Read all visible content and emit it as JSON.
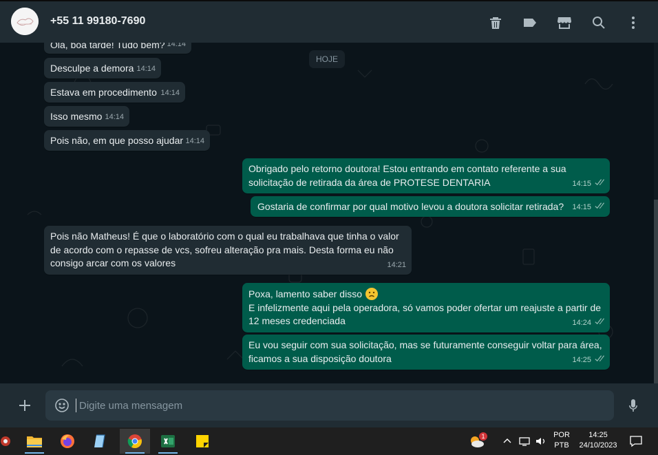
{
  "header": {
    "contact_name": "+55 11 99180-7690",
    "icons": [
      "trash-icon",
      "label-icon",
      "store-icon",
      "search-icon",
      "more-icon"
    ]
  },
  "chat": {
    "date_chip": "HOJE",
    "messages": [
      {
        "dir": "in",
        "text": "Olá, boa tarde! Tudo bem?",
        "time": "14:14"
      },
      {
        "dir": "in",
        "text": "Desculpe a demora",
        "time": "14:14"
      },
      {
        "dir": "in",
        "text": "Estava em procedimento",
        "time": "14:14"
      },
      {
        "dir": "in",
        "text": "Isso mesmo",
        "time": "14:14"
      },
      {
        "dir": "in",
        "text": "Pois não, em que posso ajudar",
        "time": "14:14"
      },
      {
        "dir": "out",
        "text": "Obrigado pelo retorno doutora! Estou entrando em contato referente a sua solicitação de retirada da área de PROTESE DENTARIA",
        "time": "14:15"
      },
      {
        "dir": "out",
        "text": "Gostaria de confirmar por qual motivo levou a doutora solicitar retirada?",
        "time": "14:15"
      },
      {
        "dir": "in",
        "text": "Pois não Matheus! É que o laboratório com o qual eu trabalhava que tinha o valor de acordo com o repasse de vcs, sofreu alteração pra mais. Desta forma eu não consigo arcar com os valores",
        "time": "14:21"
      },
      {
        "dir": "out",
        "text_line1": "Poxa, lamento saber disso",
        "text": "E infelizmente aqui pela operadora, só vamos poder ofertar um reajuste a partir de 12 meses credenciada",
        "time": "14:24"
      },
      {
        "dir": "out",
        "text": "Eu vou seguir com sua solicitação, mas se futuramente conseguir voltar para área, ficamos a sua disposição doutora",
        "time": "14:25"
      }
    ]
  },
  "composer": {
    "placeholder": "Digite uma mensagem"
  },
  "taskbar": {
    "apps": [
      "file-explorer-icon",
      "firefox-icon",
      "notepad-icon",
      "chrome-icon",
      "excel-icon",
      "sticky-notes-icon"
    ],
    "language_line1": "POR",
    "language_line2": "PTB",
    "time": "14:25",
    "date": "24/10/2023",
    "notification_count": "1"
  }
}
